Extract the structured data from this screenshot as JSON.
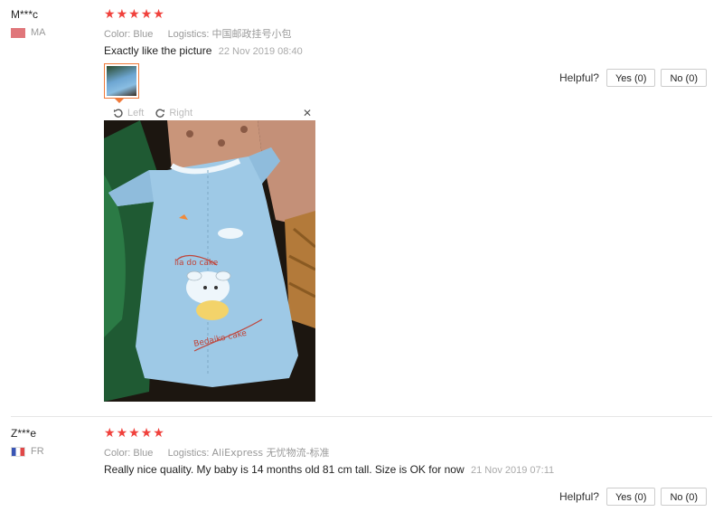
{
  "reviews": [
    {
      "user": "M***c",
      "country": "MA",
      "rating": 5,
      "color_label": "Color:",
      "color_value": "Blue",
      "logistics_label": "Logistics:",
      "logistics_value": "中国邮政挂号小包",
      "feedback": "Exactly like the picture",
      "date": "22 Nov 2019 08:40",
      "helpful_label": "Helpful?",
      "yes_label": "Yes (0)",
      "no_label": "No (0)",
      "viewer": {
        "left_label": "Left",
        "right_label": "Right",
        "close_label": "✕"
      }
    },
    {
      "user": "Z***e",
      "country": "FR",
      "rating": 5,
      "color_label": "Color:",
      "color_value": "Blue",
      "logistics_label": "Logistics:",
      "logistics_value": "AliExpress 无忧物流-标准",
      "feedback": "Really nice quality. My baby is 14 months old 81 cm tall. Size is OK for now",
      "date": "21 Nov 2019 07:11",
      "helpful_label": "Helpful?",
      "yes_label": "Yes (0)",
      "no_label": "No (0)"
    }
  ],
  "colors": {
    "star": "#f0413c",
    "thumb_border": "#f07a3a"
  },
  "icons": {
    "star": "star-icon",
    "rotate_left": "rotate-left-icon",
    "rotate_right": "rotate-right-icon",
    "close": "close-icon"
  }
}
